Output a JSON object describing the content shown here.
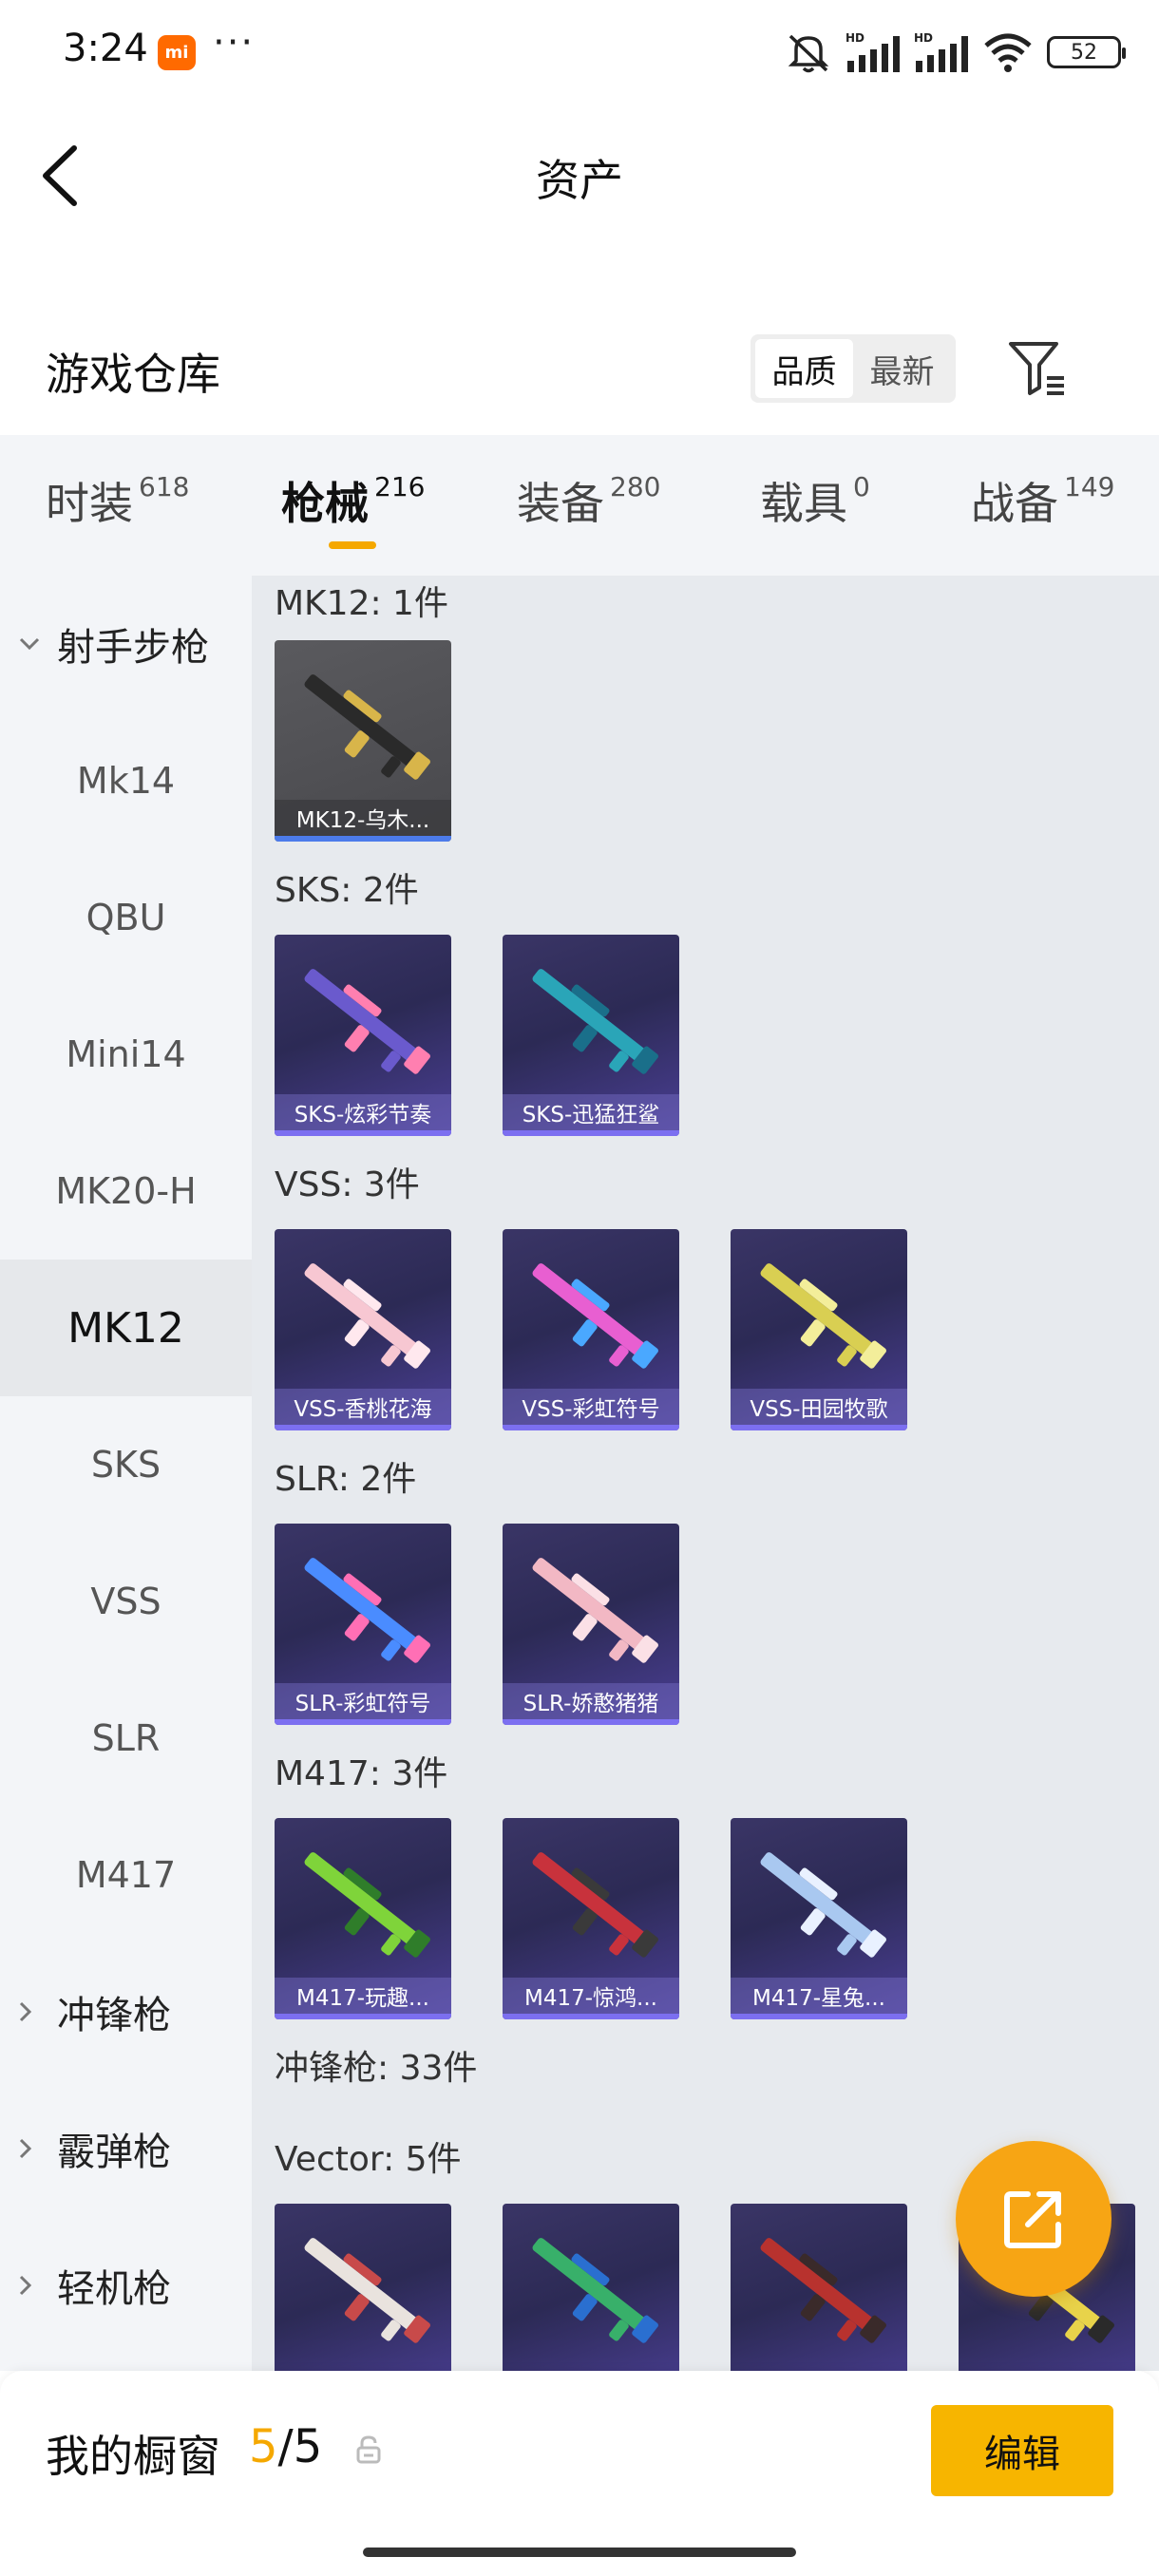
{
  "status_bar": {
    "time": "3:24",
    "mi_badge": "mi",
    "dots": "···",
    "battery": "52"
  },
  "nav": {
    "title": "资产"
  },
  "warehouse": {
    "title": "游戏仓库",
    "sort_options": [
      "品质",
      "最新"
    ],
    "active_sort": "品质"
  },
  "tabs": [
    {
      "label": "时装",
      "count": "618"
    },
    {
      "label": "枪械",
      "count": "216"
    },
    {
      "label": "装备",
      "count": "280"
    },
    {
      "label": "载具",
      "count": "0"
    },
    {
      "label": "战备",
      "count": "149"
    }
  ],
  "active_tab": "枪械",
  "sidebar": {
    "items": [
      {
        "label": "射手步枪",
        "type": "group-expanded"
      },
      {
        "label": "Mk14",
        "type": "sub"
      },
      {
        "label": "QBU",
        "type": "sub"
      },
      {
        "label": "Mini14",
        "type": "sub"
      },
      {
        "label": "MK20-H",
        "type": "sub"
      },
      {
        "label": "MK12",
        "type": "sub-active"
      },
      {
        "label": "SKS",
        "type": "sub"
      },
      {
        "label": "VSS",
        "type": "sub"
      },
      {
        "label": "SLR",
        "type": "sub"
      },
      {
        "label": "M417",
        "type": "sub"
      },
      {
        "label": "冲锋枪",
        "type": "group-collapsed"
      },
      {
        "label": "霰弹枪",
        "type": "group-collapsed"
      },
      {
        "label": "轻机枪",
        "type": "group-collapsed"
      }
    ]
  },
  "sections": [
    {
      "title": "MK12: 1件",
      "items": [
        {
          "name": "MK12-乌木...",
          "gun": "dark-gold",
          "rarity": "blue"
        }
      ]
    },
    {
      "title": "SKS: 2件",
      "items": [
        {
          "name": "SKS-炫彩节奏",
          "gun": "multicolor",
          "rarity": "purple"
        },
        {
          "name": "SKS-迅猛狂鲨",
          "gun": "teal",
          "rarity": "purple"
        }
      ]
    },
    {
      "title": "VSS: 3件",
      "items": [
        {
          "name": "VSS-香桃花海",
          "gun": "pink",
          "rarity": "purple"
        },
        {
          "name": "VSS-彩虹符号",
          "gun": "rainbow",
          "rarity": "purple"
        },
        {
          "name": "VSS-田园牧歌",
          "gun": "yellow",
          "rarity": "purple"
        }
      ]
    },
    {
      "title": "SLR: 2件",
      "items": [
        {
          "name": "SLR-彩虹符号",
          "gun": "rainbow",
          "rarity": "purple"
        },
        {
          "name": "SLR-娇憨猪猪",
          "gun": "pink",
          "rarity": "purple"
        }
      ]
    },
    {
      "title": "M417: 3件",
      "items": [
        {
          "name": "M417-玩趣...",
          "gun": "green",
          "rarity": "purple"
        },
        {
          "name": "M417-惊鸿...",
          "gun": "red",
          "rarity": "purple"
        },
        {
          "name": "M417-星兔...",
          "gun": "blue-white",
          "rarity": "purple"
        }
      ]
    }
  ],
  "group_summary": "冲锋枪: 33件",
  "vector_section": {
    "title": "Vector: 5件",
    "guns": [
      "white-red",
      "green-blue",
      "red",
      "yellow"
    ]
  },
  "bottom": {
    "showcase_label": "我的橱窗",
    "count_current": "5",
    "count_sep": "/",
    "count_total": "5",
    "edit_label": "编辑"
  },
  "colors": {
    "accent": "#f5a800",
    "edit_button": "#f7b500",
    "fab": "#f7a514",
    "card_purple": "#4b3f96",
    "rarity_purple": "#7c6ff0",
    "rarity_blue": "#4c7bea"
  }
}
